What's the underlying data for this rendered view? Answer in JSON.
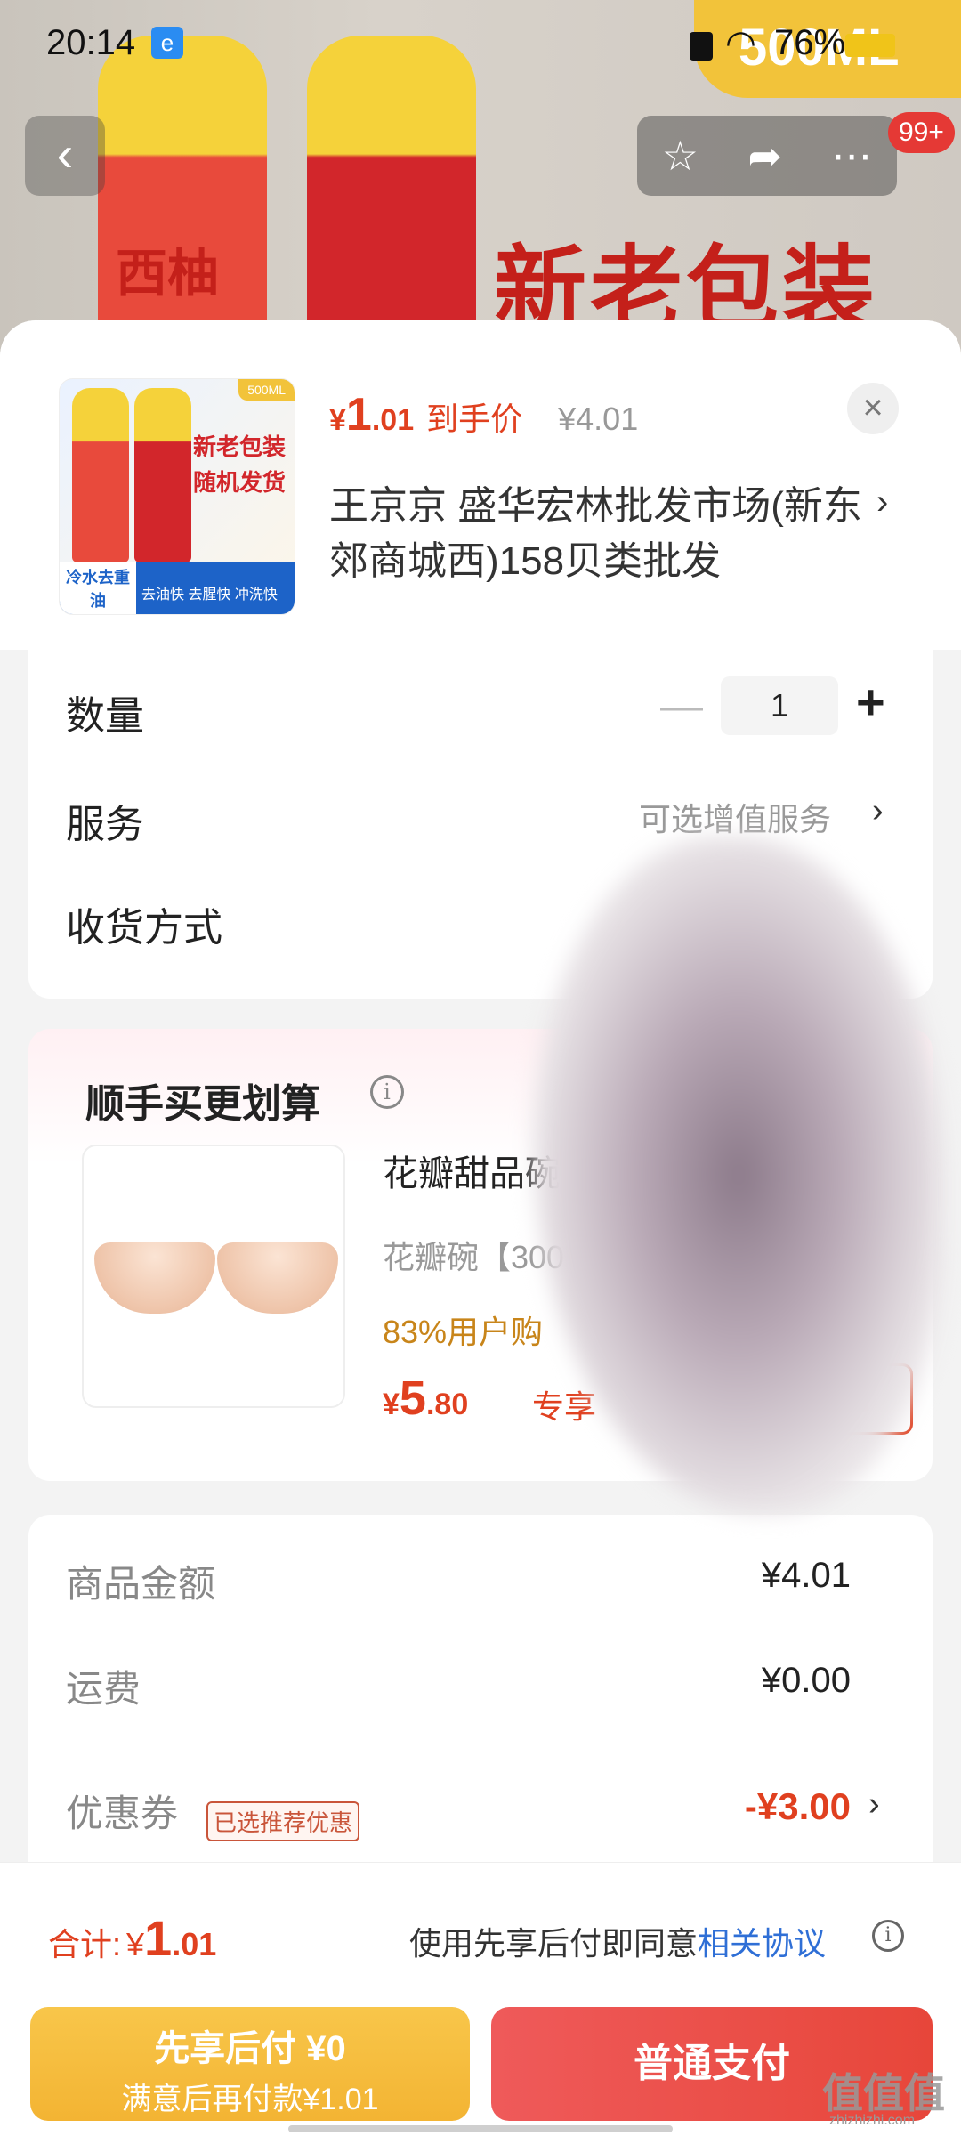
{
  "status_bar": {
    "time": "20:14",
    "battery": "76%"
  },
  "banner": {
    "headline": "新老包装",
    "volume": "500ML",
    "brand": "西柚"
  },
  "nav": {
    "back_icon": "chevron-left-icon",
    "badge": "99+"
  },
  "product": {
    "price_symbol": "¥",
    "price_int": "1",
    "price_dec": ".01",
    "price_tag": "到手价",
    "original_price": "¥4.01",
    "shop": "王京京  盛华宏林批发市场(新东郊商城西)158贝类批发",
    "thumb_texts": {
      "ml": "500ML",
      "line1": "新老包装",
      "line2": "随机发货",
      "footer_left": "冷水去重油",
      "footer_right": "去油快 去腥快 冲洗快"
    }
  },
  "options": {
    "quantity_label": "数量",
    "quantity_value": "1",
    "service_label": "服务",
    "service_value": "可选增值服务",
    "delivery_label": "收货方式"
  },
  "upsell": {
    "title": "顺手买更划算",
    "name": "花瓣甜品碗",
    "desc": "花瓣碗【300",
    "stat": "83%用户购",
    "price_symbol": "¥",
    "price_int": "5",
    "price_dec": ".80",
    "special": "专享",
    "button": "加购"
  },
  "summary": {
    "goods_label": "商品金额",
    "goods_value": "¥4.01",
    "shipping_label": "运费",
    "shipping_value": "¥0.00",
    "coupon_label": "优惠券",
    "coupon_tag": "已选推荐优惠",
    "coupon_value": "-¥3.00"
  },
  "footer": {
    "total_label": "合计:",
    "total_symbol": "¥",
    "total_int": "1",
    "total_dec": ".01",
    "agree_text": "使用先享后付即同意",
    "agree_link": "相关协议",
    "later_line1": "先享后付 ¥0",
    "later_line2": "满意后再付款¥1.01",
    "pay_button": "普通支付"
  },
  "watermark": {
    "text": "值值值",
    "sub": "zhizhizhi.com"
  },
  "colors": {
    "accent": "#e0401f",
    "later_button": "#f3b433",
    "pay_button": "#e7463a",
    "link": "#2f6fd6"
  }
}
